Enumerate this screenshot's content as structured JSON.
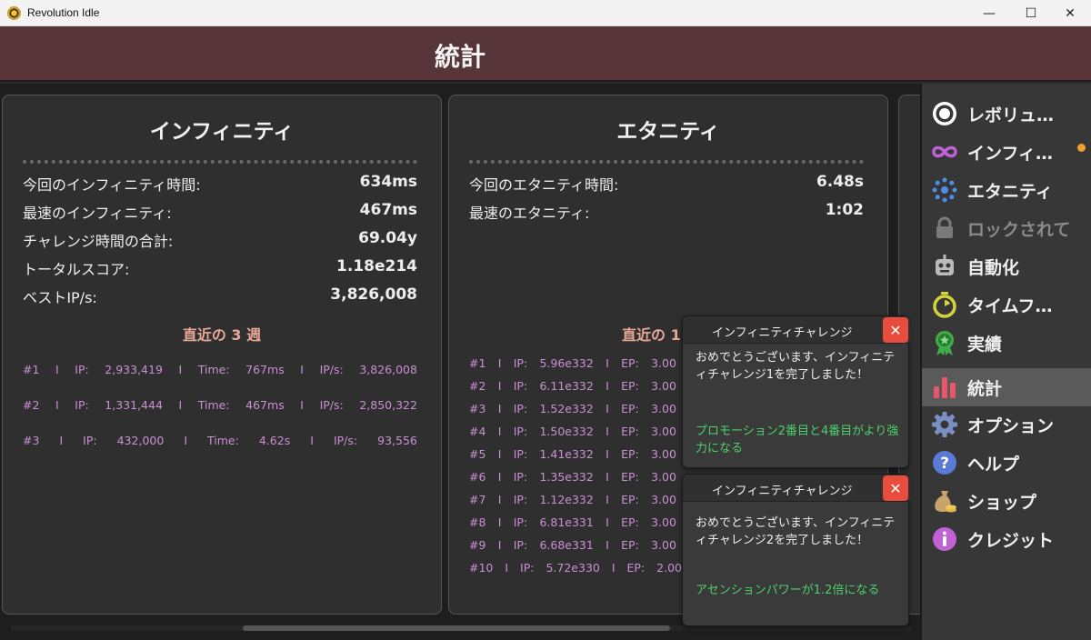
{
  "window": {
    "title": "Revolution Idle",
    "minimize": "—",
    "maximize": "☐",
    "close": "✕"
  },
  "header": {
    "title": "統計"
  },
  "infinity": {
    "title": "インフィニティ",
    "stats": [
      {
        "label": "今回のインフィニティ時間:",
        "value": "634ms"
      },
      {
        "label": "最速のインフィニティ:",
        "value": "467ms"
      },
      {
        "label": "チャレンジ時間の合計:",
        "value": "69.04y"
      },
      {
        "label": "トータルスコア:",
        "value": "1.18e214"
      },
      {
        "label": "ベストIP/s:",
        "value": "3,826,008"
      }
    ],
    "recent_title": "直近の 3 週",
    "runs": [
      [
        "#1",
        "I",
        "IP:",
        "2,933,419",
        "I",
        "Time:",
        "767ms",
        "I",
        "IP/s:",
        "3,826,008"
      ],
      [
        "#2",
        "I",
        "IP:",
        "1,331,444",
        "I",
        "Time:",
        "467ms",
        "I",
        "IP/s:",
        "2,850,322"
      ],
      [
        "#3",
        "I",
        "IP:",
        "432,000",
        "I",
        "Time:",
        "4.62s",
        "I",
        "IP/s:",
        "93,556"
      ]
    ]
  },
  "eternity": {
    "title": "エタニティ",
    "stats": [
      {
        "label": "今回のエタニティ時間:",
        "value": "6.48s"
      },
      {
        "label": "最速のエタニティ:",
        "value": "1:02"
      }
    ],
    "recent_title": "直近の 1",
    "runs": [
      [
        "#1",
        "I",
        "IP:",
        "5.96e332",
        "I",
        "EP:",
        "3.00"
      ],
      [
        "#2",
        "I",
        "IP:",
        "6.11e332",
        "I",
        "EP:",
        "3.00"
      ],
      [
        "#3",
        "I",
        "IP:",
        "1.52e332",
        "I",
        "EP:",
        "3.00"
      ],
      [
        "#4",
        "I",
        "IP:",
        "1.50e332",
        "I",
        "EP:",
        "3.00"
      ],
      [
        "#5",
        "I",
        "IP:",
        "1.41e332",
        "I",
        "EP:",
        "3.00"
      ],
      [
        "#6",
        "I",
        "IP:",
        "1.35e332",
        "I",
        "EP:",
        "3.00"
      ],
      [
        "#7",
        "I",
        "IP:",
        "1.12e332",
        "I",
        "EP:",
        "3.00"
      ],
      [
        "#8",
        "I",
        "IP:",
        "6.81e331",
        "I",
        "EP:",
        "3.00"
      ],
      [
        "#9",
        "I",
        "IP:",
        "6.68e331",
        "I",
        "EP:",
        "3.00"
      ],
      [
        "#10",
        "I",
        "IP:",
        "5.72e330",
        "I",
        "EP:",
        "2.00"
      ]
    ]
  },
  "sidebar": {
    "items": [
      {
        "label": "レボリュ…",
        "icon": "target-icon"
      },
      {
        "label": "インフィ…",
        "icon": "infinity-icon"
      },
      {
        "label": "エタニティ",
        "icon": "eternity-dots-icon"
      },
      {
        "label": "ロックされて",
        "icon": "lock-icon"
      },
      {
        "label": "自動化",
        "icon": "robot-icon"
      },
      {
        "label": "タイムフ…",
        "icon": "stopwatch-icon"
      },
      {
        "label": "実績",
        "icon": "medal-icon"
      },
      {
        "label": "統計",
        "icon": "bar-chart-icon"
      },
      {
        "label": "オプション",
        "icon": "gear-icon"
      },
      {
        "label": "ヘルプ",
        "icon": "help-icon"
      },
      {
        "label": "ショップ",
        "icon": "money-bag-icon"
      },
      {
        "label": "クレジット",
        "icon": "info-icon"
      }
    ]
  },
  "popups": [
    {
      "title": "インフィニティチャレンジ",
      "close": "✕",
      "body": "おめでとうございます、インフィニティチャレンジ1を完了しました！",
      "reward": "プロモーション2番目と4番目がより強力になる"
    },
    {
      "title": "インフィニティチャレンジ",
      "close": "✕",
      "body": "おめでとうございます、インフィニティチャレンジ2を完了しました！",
      "reward": "アセンションパワーが1.2倍になる"
    }
  ],
  "colors": {
    "header": "#583539",
    "accent_orange": "#f0a030",
    "run_text": "#c98fd3",
    "reward_green": "#4cd16a",
    "close_red": "#e74c3c"
  }
}
